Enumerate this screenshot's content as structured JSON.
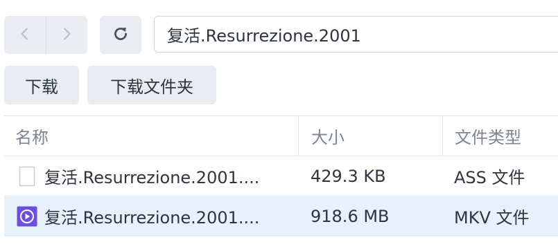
{
  "toolbar": {
    "back_icon": "chevron-left-icon",
    "forward_icon": "chevron-right-icon",
    "refresh_icon": "refresh-icon",
    "path_value": "复活.Resurrezione.2001"
  },
  "actions": {
    "download_label": "下载",
    "download_folder_label": "下载文件夹"
  },
  "table": {
    "headers": {
      "name": "名称",
      "size": "大小",
      "type": "文件类型"
    },
    "rows": [
      {
        "icon": "document-file-icon",
        "name": "复活.Resurrezione.2001....",
        "size": "429.3 KB",
        "type": "ASS 文件",
        "selected": false
      },
      {
        "icon": "video-file-icon",
        "name": "复活.Resurrezione.2001....",
        "size": "918.6 MB",
        "type": "MKV 文件",
        "selected": true
      }
    ]
  },
  "colors": {
    "button_bg": "#e9edf2",
    "selected_row_bg": "#e7f1fc",
    "video_icon": "#6d4fe0"
  }
}
